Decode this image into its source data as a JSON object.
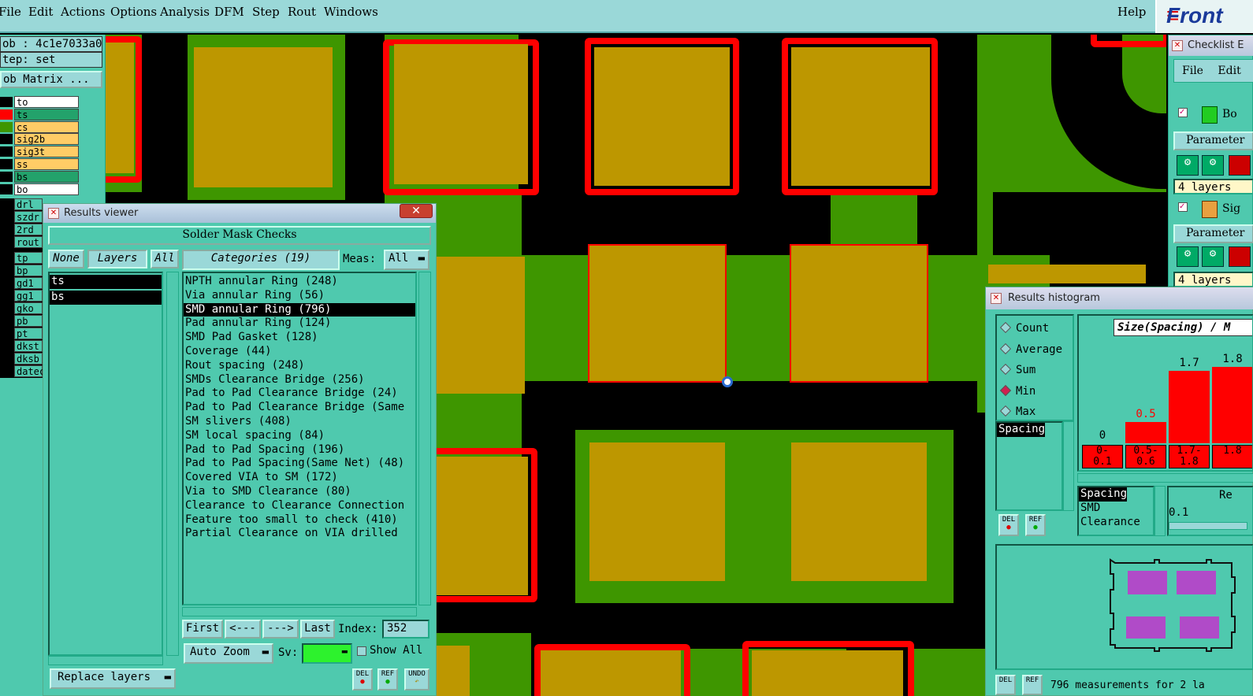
{
  "menubar": {
    "items": [
      "File",
      "Edit",
      "Actions",
      "Options",
      "Analysis",
      "DFM",
      "Step",
      "Rout",
      "Windows"
    ],
    "help": "Help",
    "logo": "Front"
  },
  "left_panel": {
    "job": "ob : 4c1e7033a0",
    "step": "tep: set",
    "matrix_button": "ob Matrix ...",
    "layers_top": [
      {
        "name": "to",
        "color": "#ffffff",
        "swatch": "#000000"
      },
      {
        "name": "ts",
        "color": "#23a26b",
        "swatch": "#ff0000"
      },
      {
        "name": "cs",
        "color": "#ffcc66",
        "swatch": "#3e9600"
      },
      {
        "name": "sig2b",
        "color": "#ffcc66",
        "swatch": "#000000"
      },
      {
        "name": "sig3t",
        "color": "#ffcc66",
        "swatch": "#000000"
      },
      {
        "name": "ss",
        "color": "#ffcc66",
        "swatch": "#000000"
      },
      {
        "name": "bs",
        "color": "#23a26b",
        "swatch": "#000000"
      },
      {
        "name": "bo",
        "color": "#ffffff",
        "swatch": "#000000"
      }
    ],
    "layers_mid": [
      "drl",
      "szdr",
      "2rd",
      "rout"
    ],
    "layers_bot": [
      "tp",
      "bp",
      "gd1",
      "gg1",
      "gko",
      "pb",
      "pt",
      "dkst",
      "dksb",
      "datec"
    ]
  },
  "results_viewer": {
    "title": "Results viewer",
    "close": "✕",
    "header": "Solder Mask Checks",
    "none_btn": "None",
    "layers_btn": "Layers",
    "all_btn": "All",
    "categories_label": "Categories (19)",
    "meas_label": "Meas:",
    "meas_value": "All",
    "layers": [
      "ts",
      "bs"
    ],
    "categories": [
      "NPTH annular Ring (248)",
      "Via annular Ring (56)",
      "SMD annular Ring (796)",
      "Pad annular Ring (124)",
      "SMD Pad Gasket (128)",
      "Coverage (44)",
      "Rout spacing (248)",
      "SMDs Clearance Bridge (256)",
      "Pad to Pad Clearance Bridge (24)",
      "Pad to Pad Clearance Bridge (Same",
      "SM slivers (408)",
      "SM local spacing (84)",
      "Pad to Pad Spacing (196)",
      "Pad to Pad Spacing(Same Net) (48)",
      "Covered VIA to SM (172)",
      "Via to SMD Clearance (80)",
      "Clearance to Clearance Connection",
      "Feature too small to check (410)",
      "Partial Clearance on VIA drilled"
    ],
    "selected_index": 2,
    "nav": {
      "first": "First",
      "prev": "<---",
      "next": "--->",
      "last": "Last",
      "index_label": "Index:",
      "index_value": "352"
    },
    "auto_zoom": "Auto Zoom",
    "sv_label": "Sv:",
    "show_all": "Show All",
    "replace_layers": "Replace layers",
    "del": "DEL",
    "ref": "REF",
    "undo": "UNDO"
  },
  "checklist": {
    "title": "Checklist E",
    "menu": [
      "File",
      "Edit"
    ],
    "item1": "Bo",
    "item2": "Sig",
    "parameters": "Parameter",
    "layers_text": "4 layers"
  },
  "histogram": {
    "title": "Results histogram",
    "radios": [
      {
        "label": "Count",
        "on": false
      },
      {
        "label": "Average",
        "on": false
      },
      {
        "label": "Sum",
        "on": false
      },
      {
        "label": "Min",
        "on": true
      },
      {
        "label": "Max",
        "on": false
      }
    ],
    "list": [
      "Spacing"
    ],
    "chart_title": "Size(Spacing) / M",
    "bars": [
      {
        "label": "0",
        "value": 0,
        "bin": "0-\n0.1",
        "labelcolor": "#000"
      },
      {
        "label": "0.5",
        "value": 0.5,
        "bin": "0.5-\n0.6",
        "labelcolor": "#f00"
      },
      {
        "label": "1.7",
        "value": 1.7,
        "bin": "1.7-\n1.8",
        "labelcolor": "#000"
      },
      {
        "label": "1.8",
        "value": 1.8,
        "bin": "1.8",
        "labelcolor": "#000"
      }
    ],
    "lower_list": [
      "Spacing",
      "SMD",
      "Clearance"
    ],
    "res_label": "Re",
    "res_value": "0.1",
    "del": "DEL",
    "ref": "REF",
    "status": "796 measurements for 2 la"
  }
}
